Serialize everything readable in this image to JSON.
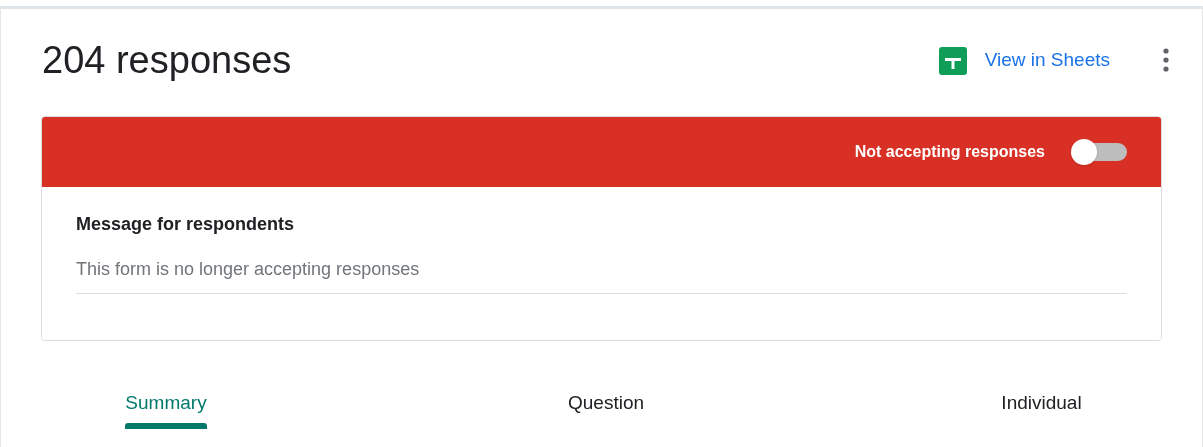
{
  "header": {
    "title": "204 responses",
    "sheets_link": "View in Sheets"
  },
  "banner": {
    "label": "Not accepting responses",
    "accepting": false
  },
  "message": {
    "label": "Message for respondents",
    "value": "This form is no longer accepting responses"
  },
  "tabs": [
    {
      "label": "Summary",
      "selected": true
    },
    {
      "label": "Question",
      "selected": false
    },
    {
      "label": "Individual",
      "selected": false
    }
  ]
}
